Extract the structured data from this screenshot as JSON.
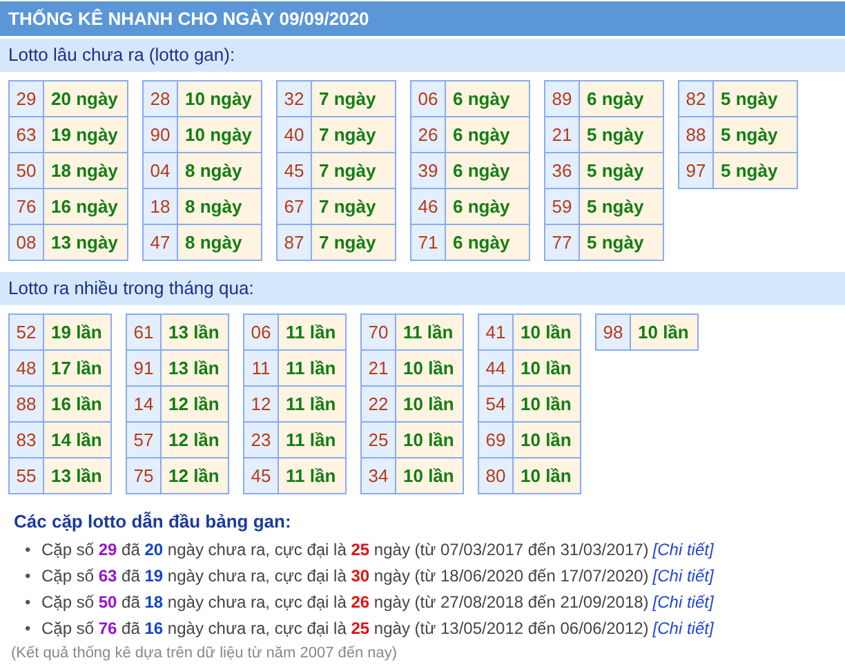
{
  "title": "THỐNG KÊ NHANH CHO NGÀY 09/09/2020",
  "gan": {
    "heading": "Lotto lâu chưa ra (lotto gan):",
    "groups": [
      [
        {
          "number": "29",
          "value": "20 ngày"
        },
        {
          "number": "63",
          "value": "19 ngày"
        },
        {
          "number": "50",
          "value": "18 ngày"
        },
        {
          "number": "76",
          "value": "16 ngày"
        },
        {
          "number": "08",
          "value": "13 ngày"
        }
      ],
      [
        {
          "number": "28",
          "value": "10 ngày"
        },
        {
          "number": "90",
          "value": "10 ngày"
        },
        {
          "number": "04",
          "value": "8 ngày"
        },
        {
          "number": "18",
          "value": "8 ngày"
        },
        {
          "number": "47",
          "value": "8 ngày"
        }
      ],
      [
        {
          "number": "32",
          "value": "7 ngày"
        },
        {
          "number": "40",
          "value": "7 ngày"
        },
        {
          "number": "45",
          "value": "7 ngày"
        },
        {
          "number": "67",
          "value": "7 ngày"
        },
        {
          "number": "87",
          "value": "7 ngày"
        }
      ],
      [
        {
          "number": "06",
          "value": "6 ngày"
        },
        {
          "number": "26",
          "value": "6 ngày"
        },
        {
          "number": "39",
          "value": "6 ngày"
        },
        {
          "number": "46",
          "value": "6 ngày"
        },
        {
          "number": "71",
          "value": "6 ngày"
        }
      ],
      [
        {
          "number": "89",
          "value": "6 ngày"
        },
        {
          "number": "21",
          "value": "5 ngày"
        },
        {
          "number": "36",
          "value": "5 ngày"
        },
        {
          "number": "59",
          "value": "5 ngày"
        },
        {
          "number": "77",
          "value": "5 ngày"
        }
      ],
      [
        {
          "number": "82",
          "value": "5 ngày"
        },
        {
          "number": "88",
          "value": "5 ngày"
        },
        {
          "number": "97",
          "value": "5 ngày"
        }
      ]
    ]
  },
  "frequent": {
    "heading": "Lotto ra nhiều trong tháng qua:",
    "groups": [
      [
        {
          "number": "52",
          "value": "19 lần"
        },
        {
          "number": "48",
          "value": "17 lần"
        },
        {
          "number": "88",
          "value": "16 lần"
        },
        {
          "number": "83",
          "value": "14 lần"
        },
        {
          "number": "55",
          "value": "13 lần"
        }
      ],
      [
        {
          "number": "61",
          "value": "13 lần"
        },
        {
          "number": "91",
          "value": "13 lần"
        },
        {
          "number": "14",
          "value": "12 lần"
        },
        {
          "number": "57",
          "value": "12 lần"
        },
        {
          "number": "75",
          "value": "12 lần"
        }
      ],
      [
        {
          "number": "06",
          "value": "11 lần"
        },
        {
          "number": "11",
          "value": "11 lần"
        },
        {
          "number": "12",
          "value": "11 lần"
        },
        {
          "number": "23",
          "value": "11 lần"
        },
        {
          "number": "45",
          "value": "11 lần"
        }
      ],
      [
        {
          "number": "70",
          "value": "11 lần"
        },
        {
          "number": "21",
          "value": "10 lần"
        },
        {
          "number": "22",
          "value": "10 lần"
        },
        {
          "number": "25",
          "value": "10 lần"
        },
        {
          "number": "34",
          "value": "10 lần"
        }
      ],
      [
        {
          "number": "41",
          "value": "10 lần"
        },
        {
          "number": "44",
          "value": "10 lần"
        },
        {
          "number": "54",
          "value": "10 lần"
        },
        {
          "number": "69",
          "value": "10 lần"
        },
        {
          "number": "80",
          "value": "10 lần"
        }
      ],
      [
        {
          "number": "98",
          "value": "10 lần"
        }
      ]
    ]
  },
  "pairs": {
    "heading": "Các cặp lotto dẫn đầu bảng gan:",
    "items": [
      {
        "bullet": "•",
        "parts": [
          {
            "kind": "plain",
            "text": "Cặp số "
          },
          {
            "kind": "pair",
            "text": "29"
          },
          {
            "kind": "plain",
            "text": " đã "
          },
          {
            "kind": "days",
            "text": "20"
          },
          {
            "kind": "plain",
            "text": " ngày chưa ra, cực đại là "
          },
          {
            "kind": "max",
            "text": "25"
          },
          {
            "kind": "plain",
            "text": " ngày (từ 07/03/2017 đến 31/03/2017)"
          }
        ],
        "link": "[Chi tiết]"
      },
      {
        "bullet": "•",
        "parts": [
          {
            "kind": "plain",
            "text": "Cặp số "
          },
          {
            "kind": "pair",
            "text": "63"
          },
          {
            "kind": "plain",
            "text": " đã "
          },
          {
            "kind": "days",
            "text": "19"
          },
          {
            "kind": "plain",
            "text": " ngày chưa ra, cực đại là "
          },
          {
            "kind": "max",
            "text": "30"
          },
          {
            "kind": "plain",
            "text": " ngày (từ 18/06/2020 đến 17/07/2020)"
          }
        ],
        "link": "[Chi tiết]"
      },
      {
        "bullet": "•",
        "parts": [
          {
            "kind": "plain",
            "text": "Cặp số "
          },
          {
            "kind": "pair",
            "text": "50"
          },
          {
            "kind": "plain",
            "text": " đã "
          },
          {
            "kind": "days",
            "text": "18"
          },
          {
            "kind": "plain",
            "text": " ngày chưa ra, cực đại là "
          },
          {
            "kind": "max",
            "text": "26"
          },
          {
            "kind": "plain",
            "text": " ngày (từ 27/08/2018 đến 21/09/2018)"
          }
        ],
        "link": "[Chi tiết]"
      },
      {
        "bullet": "•",
        "parts": [
          {
            "kind": "plain",
            "text": "Cặp số "
          },
          {
            "kind": "pair",
            "text": "76"
          },
          {
            "kind": "plain",
            "text": " đã "
          },
          {
            "kind": "days",
            "text": "16"
          },
          {
            "kind": "plain",
            "text": " ngày chưa ra, cực đại là "
          },
          {
            "kind": "max",
            "text": "25"
          },
          {
            "kind": "plain",
            "text": " ngày (từ 13/05/2012 đến 06/06/2012)"
          }
        ],
        "link": "[Chi tiết]"
      }
    ],
    "note": "(Kết quả thống kê dựa trên dữ liệu từ năm 2007 đến nay)"
  }
}
